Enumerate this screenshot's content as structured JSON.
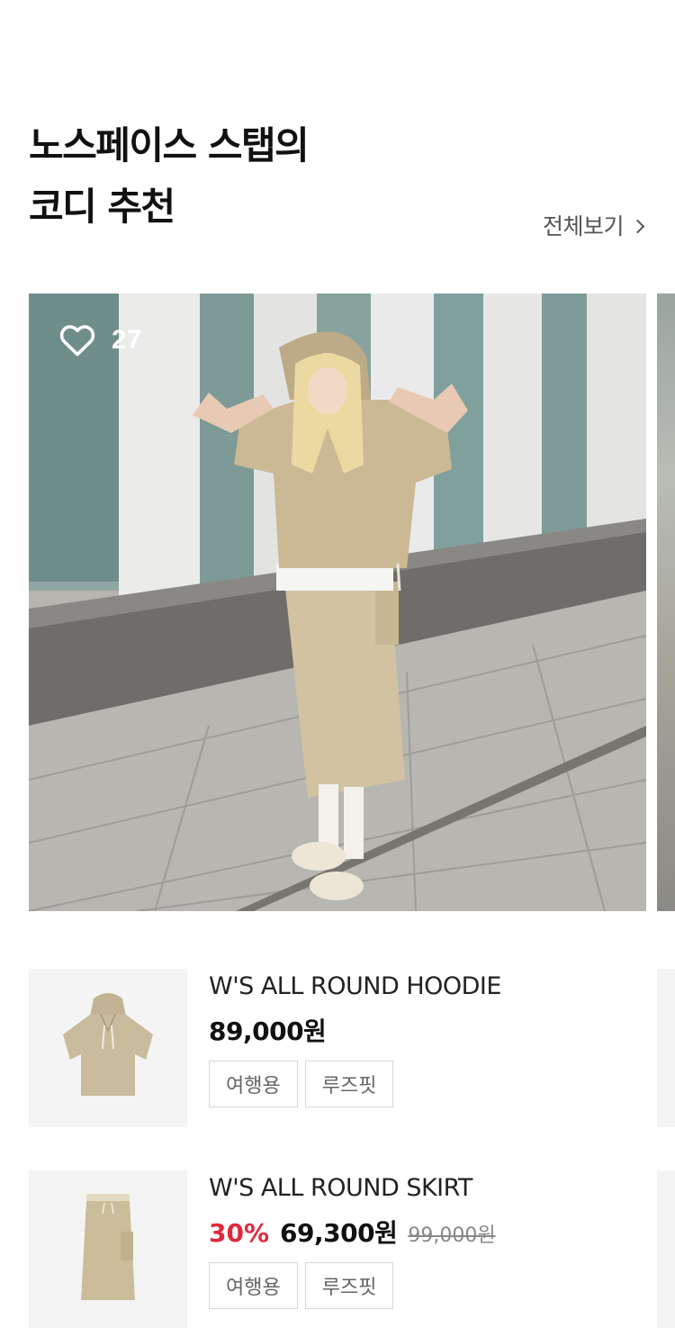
{
  "section": {
    "title_line1": "노스페이스 스탭의",
    "title_line2": "코디 추천",
    "view_all_label": "전체보기"
  },
  "hero": {
    "like_icon": "heart-outline-icon",
    "like_count": "27"
  },
  "products": [
    {
      "name": "W'S ALL ROUND HOODIE",
      "price": "89,000원",
      "discount": "",
      "original_price": "",
      "tags": [
        "여행용",
        "루즈핏"
      ]
    },
    {
      "name": "W'S ALL ROUND SKIRT",
      "price": "69,300원",
      "discount": "30%",
      "original_price": "99,000원",
      "tags": [
        "여행용",
        "루즈핏"
      ]
    }
  ],
  "colors": {
    "discount": "#e0283c",
    "text": "#111111",
    "tag_border": "#d6d6d6",
    "thumb_bg": "#f4f4f4",
    "garment_beige": "#c9b895"
  }
}
